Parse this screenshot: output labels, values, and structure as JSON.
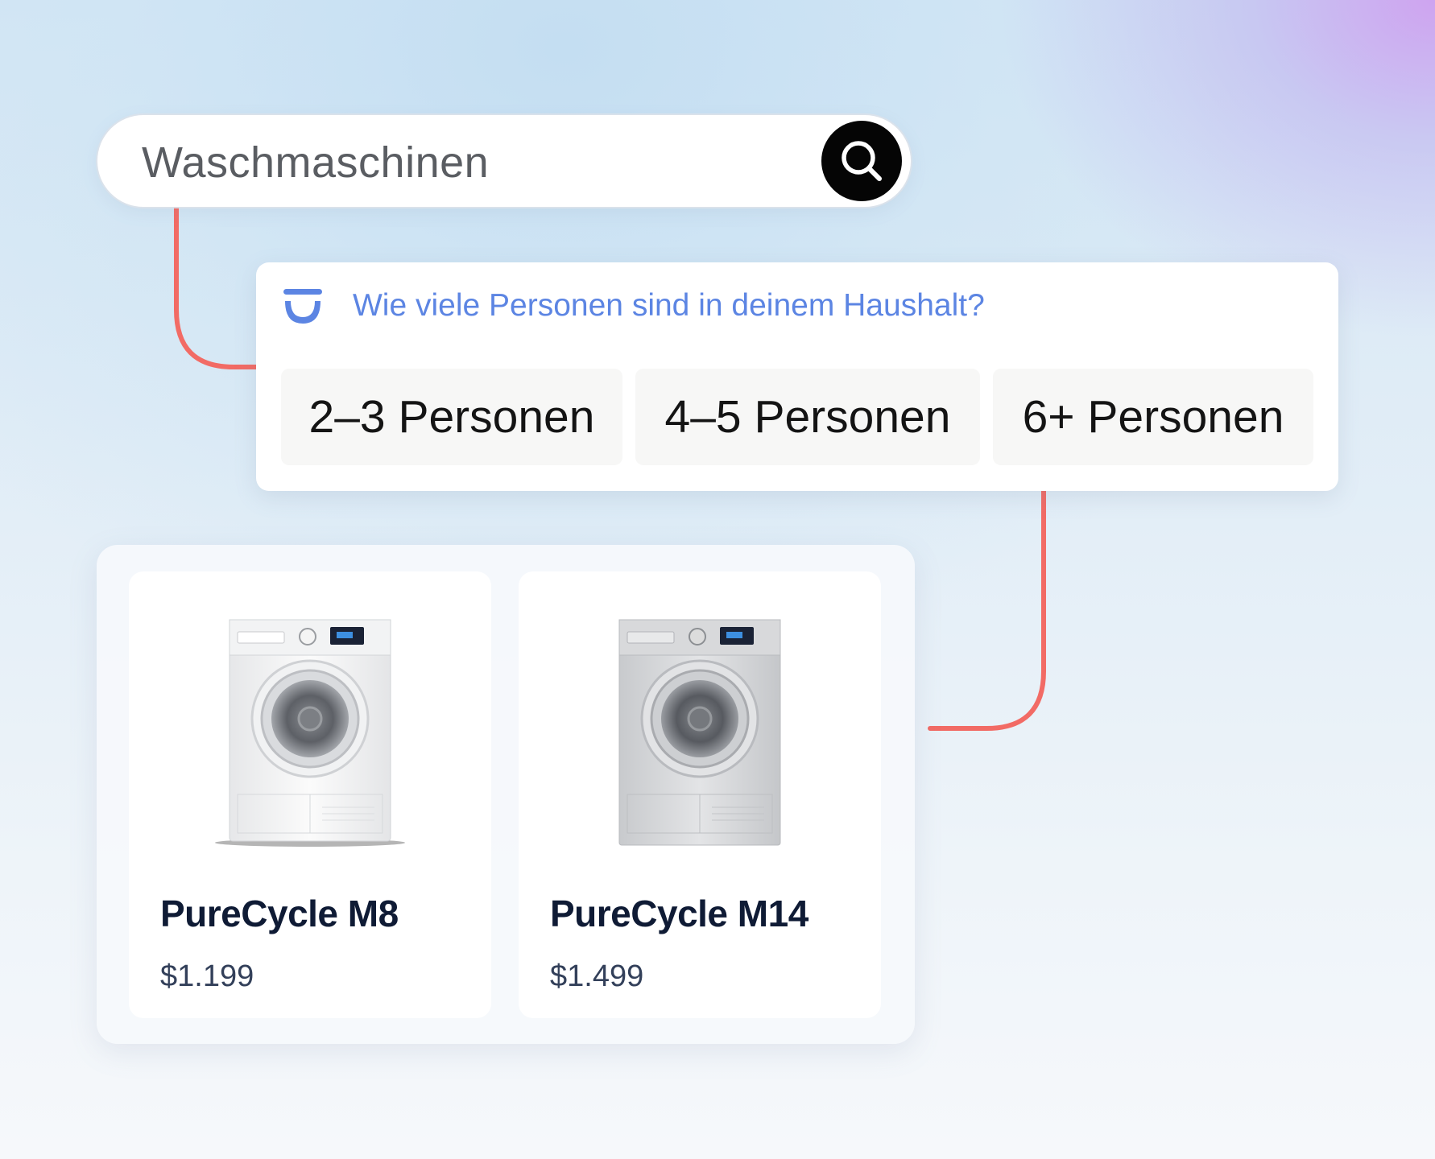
{
  "search": {
    "query": "Waschmaschinen",
    "button_icon": "search-icon"
  },
  "assistant": {
    "icon": "assistant-logo-icon",
    "question": "Wie viele Personen sind in deinem Haushalt?",
    "options": [
      {
        "label": "2–3 Personen"
      },
      {
        "label": "4–5 Personen"
      },
      {
        "label": "6+ Personen"
      }
    ]
  },
  "products": [
    {
      "name": "PureCycle M8",
      "price": "$1.199",
      "image": "washing-machine-white"
    },
    {
      "name": "PureCycle M14",
      "price": "$1.499",
      "image": "washing-machine-silver"
    }
  ],
  "colors": {
    "accent": "#5c85e3",
    "connector": "#f26b65",
    "search_button": "#050505",
    "product_title": "#0f1b35"
  }
}
